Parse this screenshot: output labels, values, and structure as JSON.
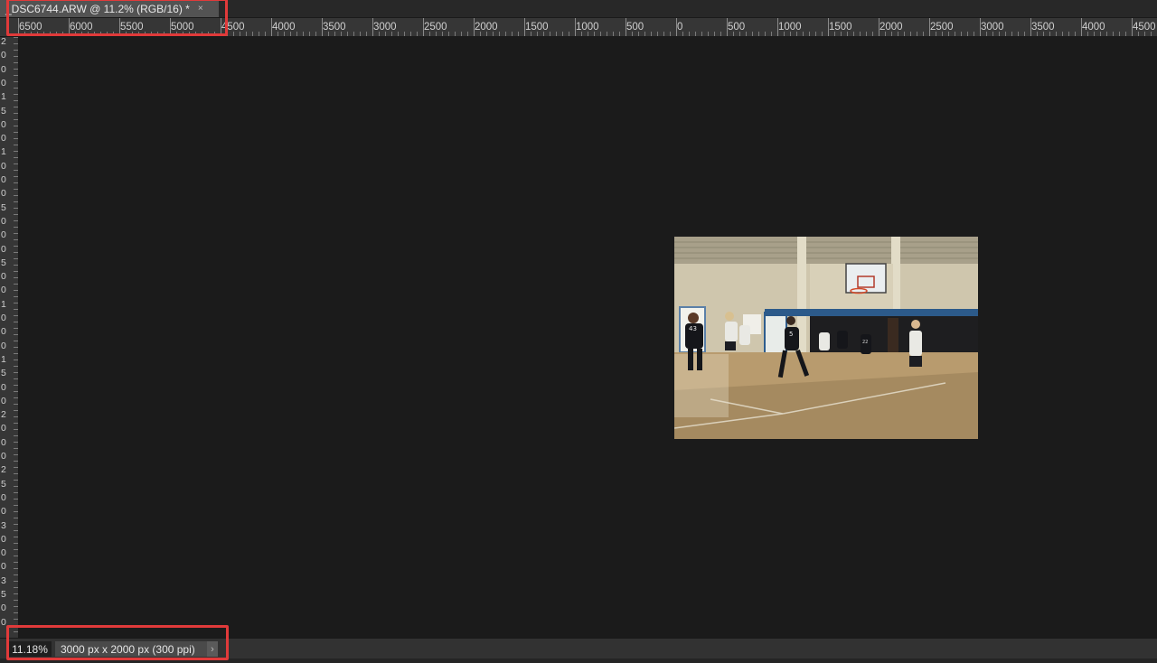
{
  "document_tab": {
    "title": "_DSC6744.ARW @ 11.2% (RGB/16) *",
    "close_glyph": "×"
  },
  "ruler_top": {
    "labels": [
      "6500",
      "6000",
      "5500",
      "5000",
      "4500",
      "4000",
      "3500",
      "3000",
      "2500",
      "2000",
      "1500",
      "1000",
      "500",
      "0",
      "500",
      "1000",
      "1500",
      "2000",
      "2500",
      "3000",
      "3500",
      "4000",
      "4500"
    ]
  },
  "ruler_left": {
    "digits": [
      "2",
      "0",
      "0",
      "0",
      "1",
      "5",
      "0",
      "0",
      "1",
      "0",
      "0",
      "0",
      "5",
      "0",
      "0",
      "0",
      "5",
      "0",
      "0",
      "1",
      "0",
      "0",
      "0",
      "1",
      "5",
      "0",
      "0",
      "2",
      "0",
      "0",
      "0",
      "2",
      "5",
      "0",
      "0",
      "3",
      "0",
      "0",
      "0",
      "3",
      "5",
      "0",
      "0"
    ]
  },
  "status_bar": {
    "zoom": "11.18%",
    "doc_info": "3000 px x 2000 px (300 ppi)",
    "arrow": "›"
  },
  "photo": {
    "description_icon": "image-icon",
    "jersey_numbers": [
      "43",
      "5",
      "22"
    ]
  },
  "colors": {
    "annotation": "#e03a3a",
    "canvas": "#1b1b1b",
    "ruler": "#363636"
  }
}
